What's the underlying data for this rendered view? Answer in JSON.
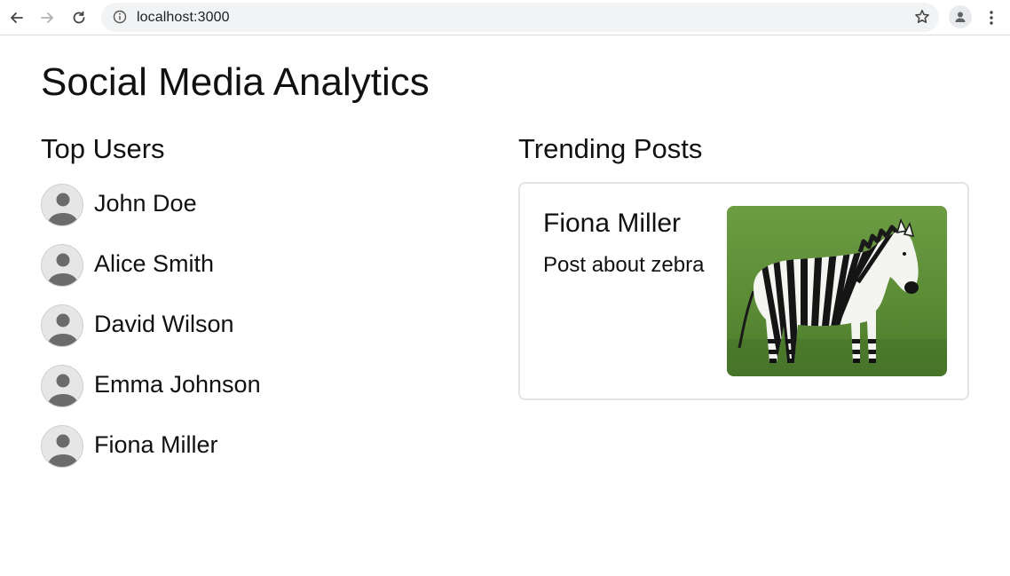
{
  "browser": {
    "url": "localhost:3000",
    "icons": [
      "back-arrow-icon",
      "forward-arrow-icon",
      "reload-icon",
      "info-icon",
      "star-icon",
      "profile-icon",
      "menu-icon"
    ]
  },
  "page": {
    "title": "Social Media Analytics"
  },
  "top_users": {
    "heading": "Top Users",
    "users": [
      {
        "name": "John Doe"
      },
      {
        "name": "Alice Smith"
      },
      {
        "name": "David Wilson"
      },
      {
        "name": "Emma Johnson"
      },
      {
        "name": "Fiona Miller"
      }
    ]
  },
  "trending_posts": {
    "heading": "Trending Posts",
    "posts": [
      {
        "author": "Fiona Miller",
        "text": "Post about zebra"
      }
    ]
  },
  "colors": {
    "address_bar_bg": "#f1f3f4",
    "card_border": "#e3e3e3",
    "grass": "#5f8f3a"
  }
}
